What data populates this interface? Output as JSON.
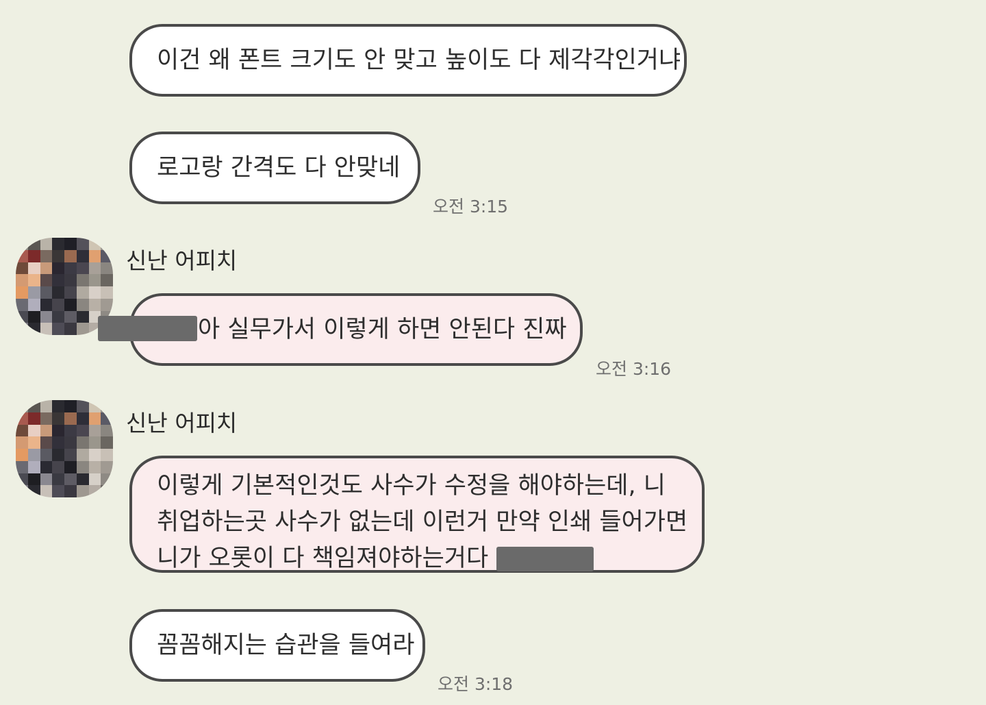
{
  "messages": [
    {
      "text": "이건 왜 폰트 크기도 안 맞고 높이도 다 제각각인거냐"
    },
    {
      "text": "로고랑 간격도 다 안맞네",
      "time": "오전 3:15"
    },
    {
      "sender": "신난 어피치",
      "text": "아 실무가서 이렇게 하면 안된다 진짜",
      "time": "오전 3:16"
    },
    {
      "sender": "신난 어피치",
      "lines": [
        "이렇게 기본적인것도 사수가 수정을 해야하는데, 니",
        "취업하는곳 사수가 없는데 이런거 만약 인쇄 들어가면",
        "니가 오롯이 다 책임져야하는거다"
      ]
    },
    {
      "text": "꼼꼼해지는 습관을 들여라",
      "time": "오전 3:18"
    }
  ],
  "avatar": {
    "icon": "pixelated-profile-icon"
  },
  "colors": {
    "background": "#eef0e3",
    "bubble_plain": "#ffffff",
    "bubble_pink": "#fbeced",
    "bubble_border": "#4a4a4a",
    "redaction": "#6a6a6a"
  }
}
